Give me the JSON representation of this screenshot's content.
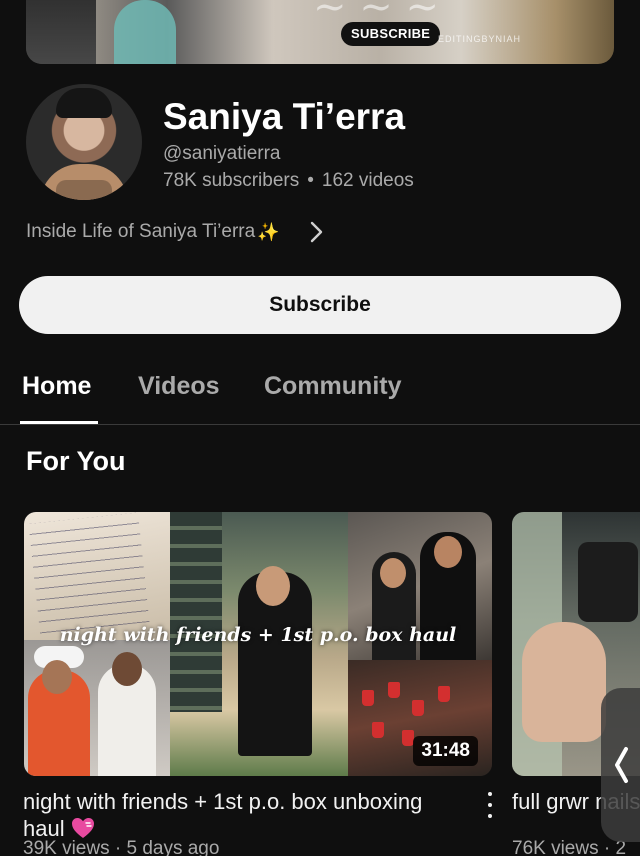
{
  "banner": {
    "subscribe_label": "SUBSCRIBE",
    "credit": "EDITINGBYNIAH"
  },
  "channel": {
    "name": "Saniya Ti’erra",
    "handle": "@saniyatierra",
    "subscribers": "78K subscribers",
    "videos": "162 videos",
    "separator": "•",
    "description": "Inside Life of Saniya Ti’erra"
  },
  "actions": {
    "subscribe_label": "Subscribe"
  },
  "tabs": [
    {
      "label": "Home",
      "active": true
    },
    {
      "label": "Videos",
      "active": false
    },
    {
      "label": "Community",
      "active": false
    }
  ],
  "section": {
    "title": "For You"
  },
  "videos": [
    {
      "title": "night with friends + 1st p.o. box unboxing haul",
      "thumbnail_text": "night with friends + 1st p.o. box haul",
      "duration": "31:48",
      "meta": "39K views · 5 days ago"
    },
    {
      "title": "full grwr nails/toe",
      "meta": "76K views · 2"
    }
  ],
  "colors": {
    "background": "#0f0f0f",
    "text_primary": "#f1f1f1",
    "text_secondary": "#aaaaaa",
    "subscribe_bg": "#f1f1f1",
    "heart": "#e84aa0"
  },
  "icons": [
    "sparkle-icon",
    "chevron-right-icon",
    "heart-icon",
    "more-vert-icon",
    "chevron-left-icon"
  ]
}
